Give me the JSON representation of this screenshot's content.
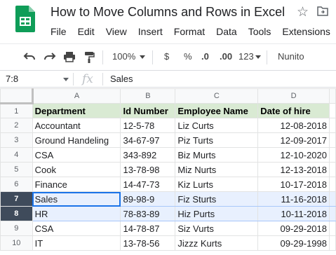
{
  "app": {
    "title": "How to Move Columns and Rows in Excel",
    "menu": [
      "File",
      "Edit",
      "View",
      "Insert",
      "Format",
      "Data",
      "Tools",
      "Extensions"
    ]
  },
  "toolbar": {
    "zoom": "100%",
    "currency": "$",
    "percent": "%",
    "decrease_decimal": ".0",
    "increase_decimal": ".00",
    "more_formats": "123",
    "font": "Nunito"
  },
  "formula_bar": {
    "name_box": "7:8",
    "fx": "fx",
    "value": "Sales"
  },
  "sheet": {
    "columns": [
      "A",
      "B",
      "C",
      "D"
    ],
    "selected_rows": [
      7,
      8
    ],
    "rows": [
      {
        "num": "1",
        "cells": [
          "Department",
          "Id Number",
          "Employee Name",
          "Date of hire"
        ]
      },
      {
        "num": "2",
        "cells": [
          "Accountant",
          "12-5-78",
          "Liz Curts",
          "12-08-2018"
        ]
      },
      {
        "num": "3",
        "cells": [
          "Ground Handeling",
          "34-67-97",
          "Piz Turts",
          "12-09-2017"
        ]
      },
      {
        "num": "4",
        "cells": [
          "CSA",
          "343-892",
          "Biz Murts",
          "12-10-2020"
        ]
      },
      {
        "num": "5",
        "cells": [
          "Cook",
          "13-78-98",
          "Miz Nurts",
          "12-13-2018"
        ]
      },
      {
        "num": "6",
        "cells": [
          "Finance",
          "14-47-73",
          "Kiz Lurts",
          "10-17-2018"
        ]
      },
      {
        "num": "7",
        "cells": [
          "Sales",
          "89-98-9",
          "Fiz Sturts",
          "11-16-2018"
        ]
      },
      {
        "num": "8",
        "cells": [
          "HR",
          "78-83-89",
          "Hiz Purts",
          "10-11-2018"
        ]
      },
      {
        "num": "9",
        "cells": [
          "CSA",
          "14-78-87",
          "Siz Vurts",
          "09-29-2018"
        ]
      },
      {
        "num": "10",
        "cells": [
          "IT",
          "13-78-56",
          "Jizzz Kurts",
          "09-29-1998"
        ]
      }
    ]
  },
  "colors": {
    "header_fill": "#d9ead3",
    "selection_fill": "#e8f0fe",
    "selection_border": "#1a73e8",
    "selected_rowhead": "#3f4b5b",
    "sheets_green": "#0f9d58"
  }
}
